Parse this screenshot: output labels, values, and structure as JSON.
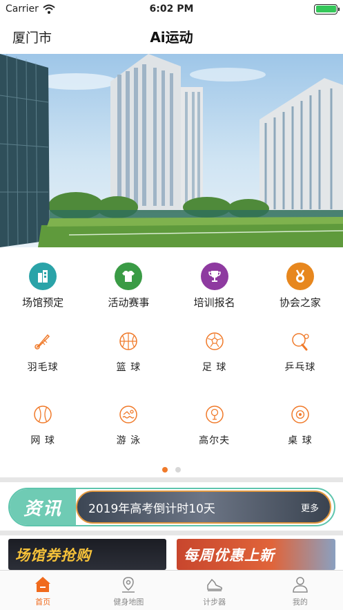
{
  "status_bar": {
    "carrier": "Carrier",
    "time": "6:02 PM"
  },
  "nav": {
    "city": "厦门市",
    "title": "Ai运动"
  },
  "categories": [
    {
      "label": "场馆预定",
      "icon": "building-icon",
      "color": "#2aa3a8"
    },
    {
      "label": "活动赛事",
      "icon": "jersey-icon",
      "color": "#3a9b45"
    },
    {
      "label": "培训报名",
      "icon": "trophy-icon",
      "color": "#8e3aa0"
    },
    {
      "label": "协会之家",
      "icon": "medal-icon",
      "color": "#e7871e"
    }
  ],
  "sports": [
    {
      "label": "羽毛球",
      "icon": "shuttlecock-icon"
    },
    {
      "label": "篮 球",
      "icon": "basketball-icon"
    },
    {
      "label": "足 球",
      "icon": "football-icon"
    },
    {
      "label": "乒乓球",
      "icon": "pingpong-icon"
    },
    {
      "label": "网 球",
      "icon": "tennis-icon"
    },
    {
      "label": "游 泳",
      "icon": "swimming-icon"
    },
    {
      "label": "高尔夫",
      "icon": "golf-icon"
    },
    {
      "label": "桌 球",
      "icon": "billiards-icon"
    }
  ],
  "news": {
    "badge": "资讯",
    "text": "2019年高考倒计时10天",
    "more": "更多"
  },
  "promos": [
    {
      "title": "场馆券抢购"
    },
    {
      "title": "每周优惠上新"
    }
  ],
  "tabs": [
    {
      "label": "首页",
      "icon": "home-icon",
      "active": true
    },
    {
      "label": "健身地图",
      "icon": "map-pin-icon",
      "active": false
    },
    {
      "label": "计步器",
      "icon": "shoe-icon",
      "active": false
    },
    {
      "label": "我的",
      "icon": "user-icon",
      "active": false
    }
  ],
  "colors": {
    "accent": "#f06a1c",
    "icon_stroke": "#f07a2a",
    "news_green": "#6fcbb4"
  }
}
